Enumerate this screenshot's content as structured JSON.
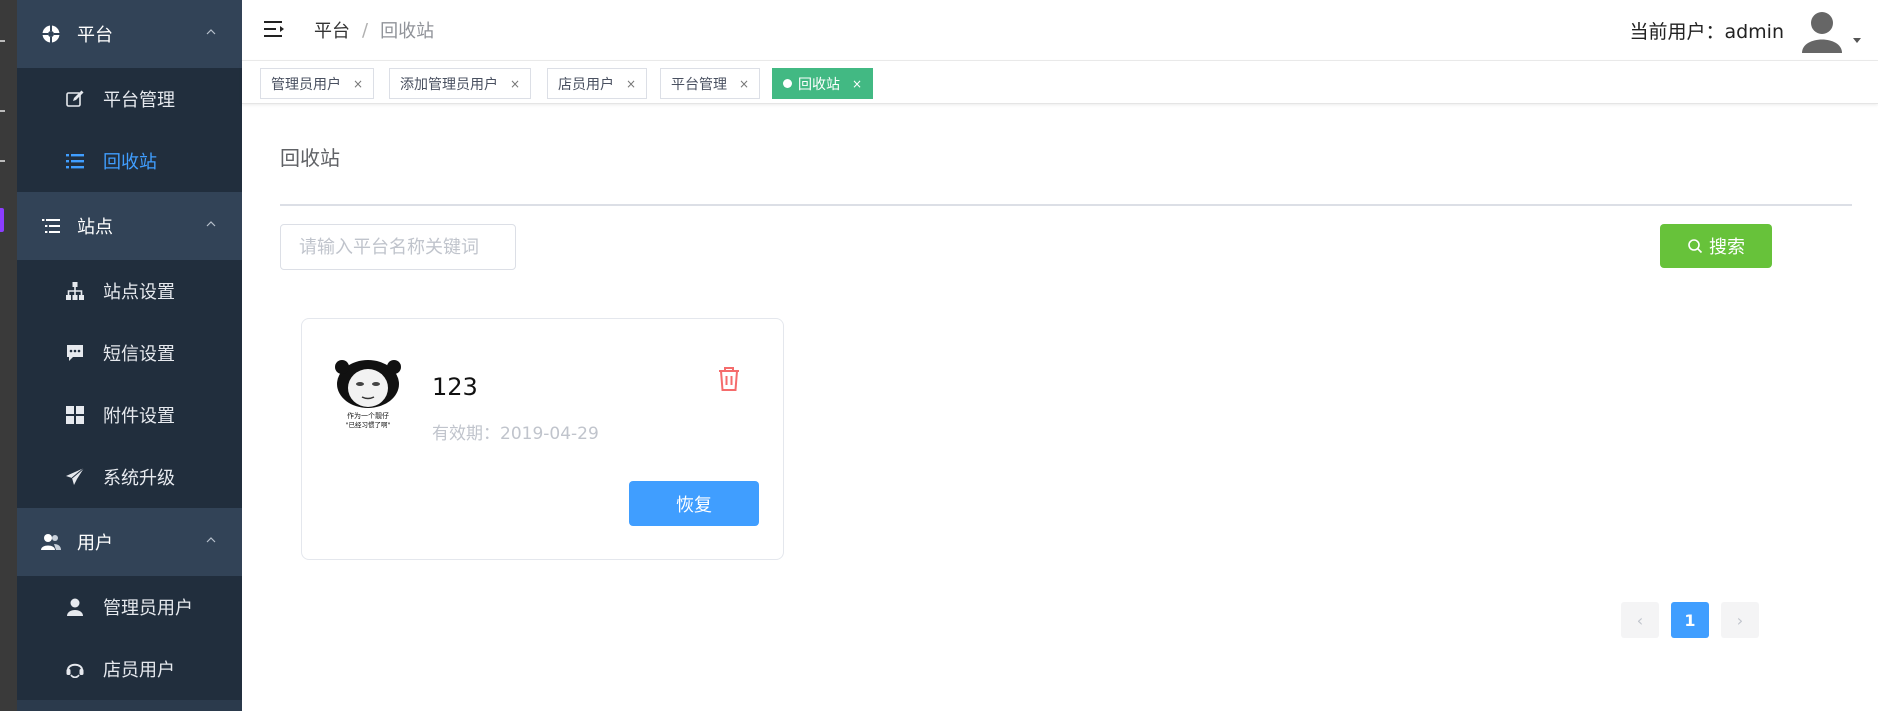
{
  "sidebar": {
    "groups": [
      {
        "label": "平台",
        "items": [
          {
            "label": "平台管理"
          },
          {
            "label": "回收站"
          }
        ]
      },
      {
        "label": "站点",
        "items": [
          {
            "label": "站点设置"
          },
          {
            "label": "短信设置"
          },
          {
            "label": "附件设置"
          },
          {
            "label": "系统升级"
          }
        ]
      },
      {
        "label": "用户",
        "items": [
          {
            "label": "管理员用户"
          },
          {
            "label": "店员用户"
          }
        ]
      }
    ]
  },
  "header": {
    "breadcrumb": [
      "平台",
      "回收站"
    ],
    "breadcrumb_sep": "/",
    "current_user_label": "当前用户：admin"
  },
  "tags": [
    {
      "label": "管理员用户",
      "close": "×"
    },
    {
      "label": "添加管理员用户",
      "close": "×"
    },
    {
      "label": "店员用户",
      "close": "×"
    },
    {
      "label": "平台管理",
      "close": "×"
    },
    {
      "label": "回收站",
      "close": "×",
      "active": true
    }
  ],
  "main": {
    "title": "回收站",
    "search": {
      "placeholder": "请输入平台名称关键词",
      "value": "",
      "button_label": "搜索"
    },
    "cards": [
      {
        "title": "123",
        "expiry": "有效期：2019-04-29",
        "restore_label": "恢复",
        "image_caption_1": "作为一个靓仔",
        "image_caption_2": "\"已经习惯了啊\""
      }
    ],
    "pagination": {
      "current_page": "1",
      "prev": "‹",
      "next": "›"
    }
  },
  "colors": {
    "sidebar_bg": "#2b3a4c",
    "active_blue": "#409eff",
    "tag_active": "#42b983",
    "search_green": "#67c23a",
    "delete_red": "#f56c6c"
  }
}
